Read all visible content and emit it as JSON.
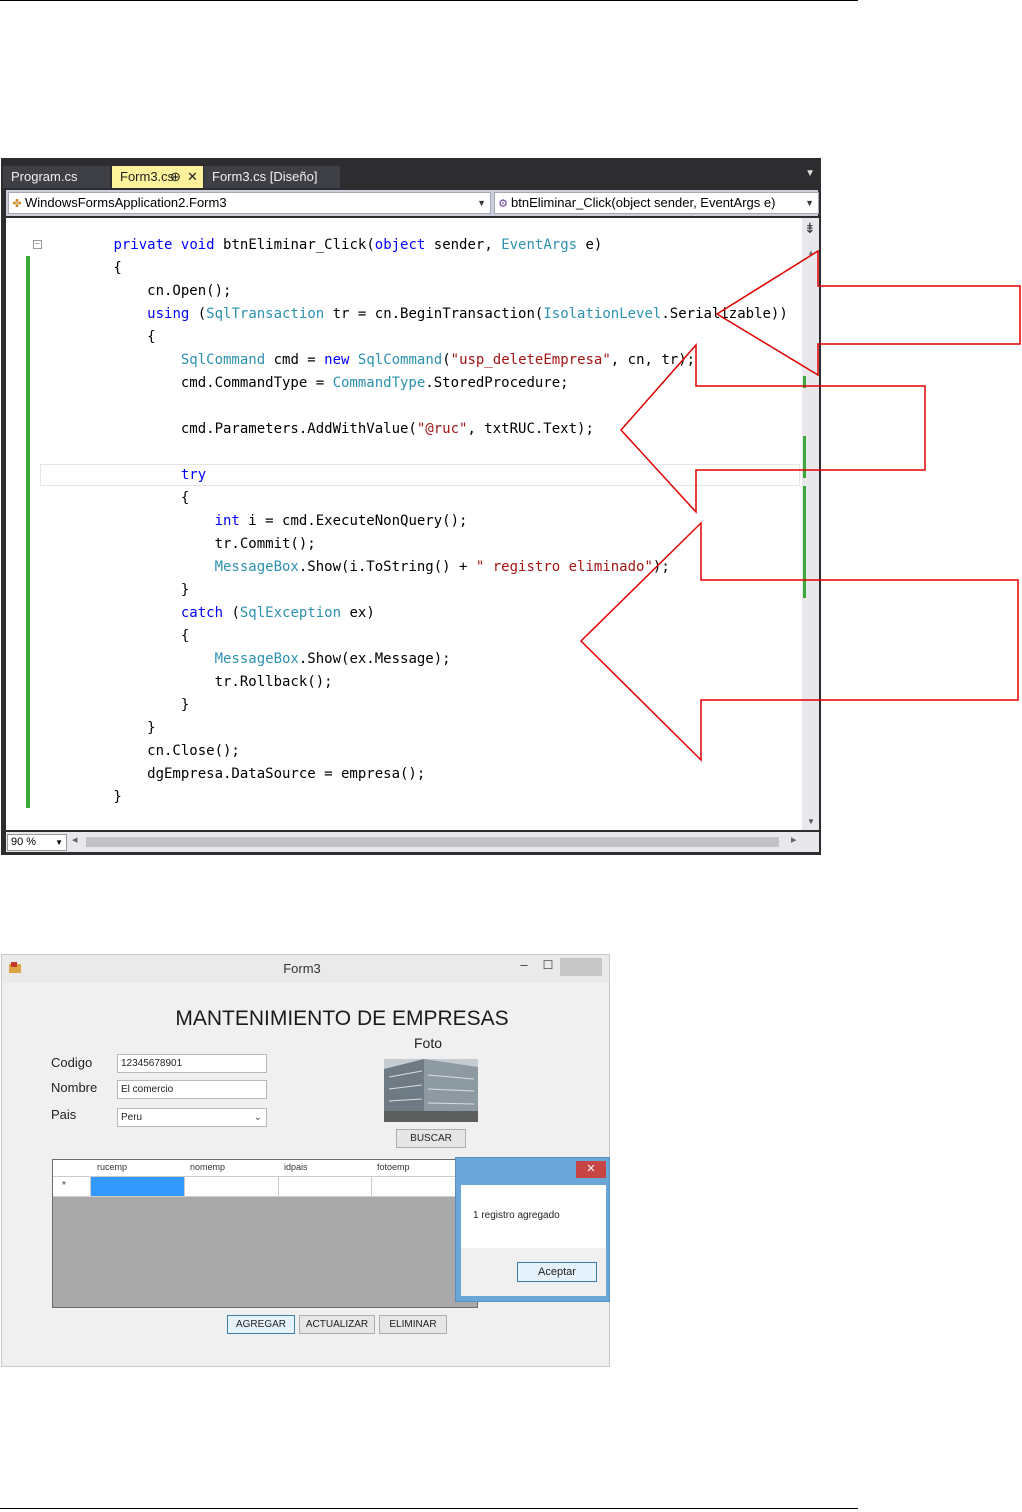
{
  "ide": {
    "tabs": [
      {
        "label": "Program.cs"
      },
      {
        "label": "Form3.cs",
        "pin": "⊕",
        "close": "✕"
      },
      {
        "label": "Form3.cs [Diseño]"
      }
    ],
    "class_combo": "WindowsFormsApplication2.Form3",
    "member_combo": "btnEliminar_Click(object sender, EventArgs e)",
    "zoom": "90 %",
    "code_lines": [
      [
        {
          "t": "        "
        },
        {
          "t": "private",
          "c": "kw"
        },
        {
          "t": " "
        },
        {
          "t": "void",
          "c": "kw"
        },
        {
          "t": " btnEliminar_Click("
        },
        {
          "t": "object",
          "c": "kw"
        },
        {
          "t": " sender, "
        },
        {
          "t": "EventArgs",
          "c": "ty"
        },
        {
          "t": " e)"
        }
      ],
      [
        {
          "t": "        {"
        }
      ],
      [
        {
          "t": "            cn.Open();"
        }
      ],
      [
        {
          "t": "            "
        },
        {
          "t": "using",
          "c": "kw"
        },
        {
          "t": " ("
        },
        {
          "t": "SqlTransaction",
          "c": "ty"
        },
        {
          "t": " tr = cn.BeginTransaction("
        },
        {
          "t": "IsolationLevel",
          "c": "ty"
        },
        {
          "t": ".Serializable))"
        }
      ],
      [
        {
          "t": "            {"
        }
      ],
      [
        {
          "t": "                "
        },
        {
          "t": "SqlCommand",
          "c": "ty"
        },
        {
          "t": " cmd = "
        },
        {
          "t": "new",
          "c": "kw"
        },
        {
          "t": " "
        },
        {
          "t": "SqlCommand",
          "c": "ty"
        },
        {
          "t": "("
        },
        {
          "t": "\"usp_deleteEmpresa\"",
          "c": "st"
        },
        {
          "t": ", cn, tr);"
        }
      ],
      [
        {
          "t": "                cmd.CommandType = "
        },
        {
          "t": "CommandType",
          "c": "ty"
        },
        {
          "t": ".StoredProcedure;"
        }
      ],
      [
        {
          "t": ""
        }
      ],
      [
        {
          "t": "                cmd.Parameters.AddWithValue("
        },
        {
          "t": "\"@ruc\"",
          "c": "st"
        },
        {
          "t": ", txtRUC.Text);"
        }
      ],
      [
        {
          "t": ""
        }
      ],
      [
        {
          "t": "                "
        },
        {
          "t": "try",
          "c": "kw"
        }
      ],
      [
        {
          "t": "                {"
        }
      ],
      [
        {
          "t": "                    "
        },
        {
          "t": "int",
          "c": "kw"
        },
        {
          "t": " i = cmd.ExecuteNonQuery();"
        }
      ],
      [
        {
          "t": "                    tr.Commit();"
        }
      ],
      [
        {
          "t": "                    "
        },
        {
          "t": "MessageBox",
          "c": "ty"
        },
        {
          "t": ".Show(i.ToString() + "
        },
        {
          "t": "\" registro eliminado\"",
          "c": "st"
        },
        {
          "t": ");"
        }
      ],
      [
        {
          "t": "                }"
        }
      ],
      [
        {
          "t": "                "
        },
        {
          "t": "catch",
          "c": "kw"
        },
        {
          "t": " ("
        },
        {
          "t": "SqlException",
          "c": "ty"
        },
        {
          "t": " ex)"
        }
      ],
      [
        {
          "t": "                {"
        }
      ],
      [
        {
          "t": "                    "
        },
        {
          "t": "MessageBox",
          "c": "ty"
        },
        {
          "t": ".Show(ex.Message);"
        }
      ],
      [
        {
          "t": "                    tr.Rollback();"
        }
      ],
      [
        {
          "t": "                }"
        }
      ],
      [
        {
          "t": "            }"
        }
      ],
      [
        {
          "t": "            cn.Close();"
        }
      ],
      [
        {
          "t": "            dgEmpresa.DataSource = empresa();"
        }
      ],
      [
        {
          "t": "        }"
        }
      ]
    ],
    "colors": {
      "keyword": "#0000ff",
      "type": "#2b91af",
      "string": "#a31515",
      "arrow": "#e00000",
      "active_tab": "#fff29d"
    }
  },
  "form": {
    "title": "Form3",
    "heading": "MANTENIMIENTO DE EMPRESAS",
    "labels": {
      "codigo": "Codigo",
      "nombre": "Nombre",
      "pais": "Pais",
      "foto": "Foto"
    },
    "values": {
      "codigo": "12345678901",
      "nombre": "El comercio",
      "pais": "Peru"
    },
    "buttons": {
      "buscar": "BUSCAR",
      "agregar": "AGREGAR",
      "actualizar": "ACTUALIZAR",
      "eliminar": "ELIMINAR"
    },
    "grid": {
      "columns": [
        "rucemp",
        "nomemp",
        "idpais",
        "fotoemp"
      ],
      "new_row_marker": "*"
    },
    "messagebox": {
      "text": "1 registro agregado",
      "ok": "Aceptar",
      "close": "✕"
    }
  }
}
